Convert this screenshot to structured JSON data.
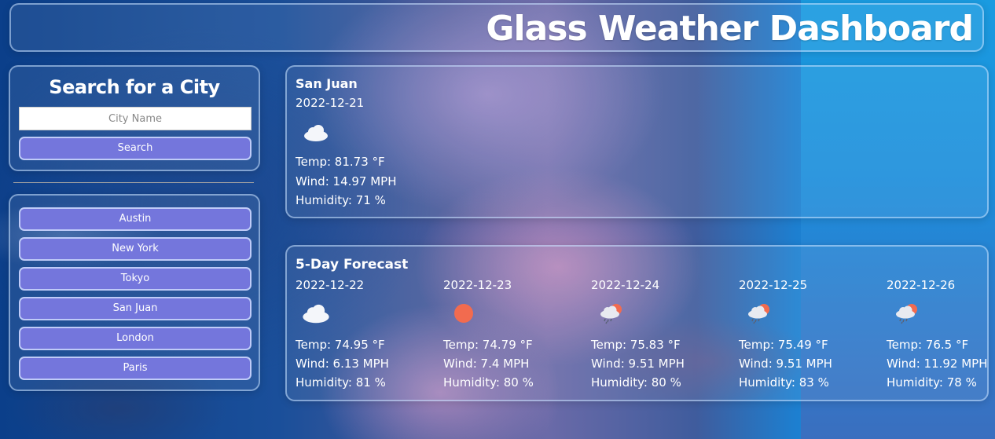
{
  "header": {
    "title": "Glass Weather Dashboard"
  },
  "search": {
    "heading": "Search for a City",
    "placeholder": "City Name",
    "button_label": "Search"
  },
  "history": [
    "Austin",
    "New York",
    "Tokyo",
    "San Juan",
    "London",
    "Paris"
  ],
  "current": {
    "city": "San Juan",
    "date": "2022-12-21",
    "icon": "cloud-icon",
    "temp": "Temp: 81.73 °F",
    "wind": "Wind: 14.97 MPH",
    "humidity": "Humidity: 71 %"
  },
  "forecast": {
    "title": "5-Day Forecast",
    "days": [
      {
        "date": "2022-12-22",
        "icon": "cloud-icon",
        "temp": "Temp: 74.95 °F",
        "wind": "Wind: 6.13 MPH",
        "humidity": "Humidity: 81 %"
      },
      {
        "date": "2022-12-23",
        "icon": "sun-icon",
        "temp": "Temp: 74.79 °F",
        "wind": "Wind: 7.4 MPH",
        "humidity": "Humidity: 80 %"
      },
      {
        "date": "2022-12-24",
        "icon": "rain-sun-cloud-icon",
        "temp": "Temp: 75.83 °F",
        "wind": "Wind: 9.51 MPH",
        "humidity": "Humidity: 80 %"
      },
      {
        "date": "2022-12-25",
        "icon": "rain-sun-cloud-icon",
        "temp": "Temp: 75.49 °F",
        "wind": "Wind: 9.51 MPH",
        "humidity": "Humidity: 83 %"
      },
      {
        "date": "2022-12-26",
        "icon": "rain-sun-cloud-icon",
        "temp": "Temp: 76.5 °F",
        "wind": "Wind: 11.92 MPH",
        "humidity": "Humidity: 78 %"
      }
    ]
  },
  "colors": {
    "button": "#7476dc",
    "border": "#c8e1ff",
    "sun": "#f26b4f"
  }
}
